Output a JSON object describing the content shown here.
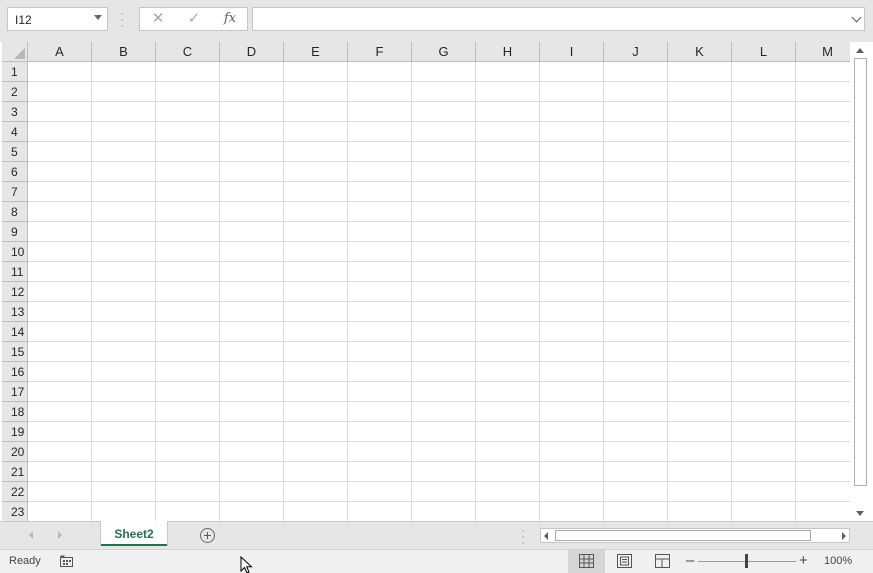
{
  "formula_bar": {
    "name_box_value": "I12",
    "cancel_icon": "✕",
    "enter_icon": "✓",
    "function_icon": "fx",
    "formula_value": ""
  },
  "grid": {
    "columns": [
      "A",
      "B",
      "C",
      "D",
      "E",
      "F",
      "G",
      "H",
      "I",
      "J",
      "K",
      "L",
      "M"
    ],
    "rows": [
      "1",
      "2",
      "3",
      "4",
      "5",
      "6",
      "7",
      "8",
      "9",
      "10",
      "11",
      "12",
      "13",
      "14",
      "15",
      "16",
      "17",
      "18",
      "19",
      "20",
      "21",
      "22",
      "23"
    ]
  },
  "sheet_tabs": {
    "active": "Sheet2",
    "add_icon": "+"
  },
  "status_bar": {
    "status": "Ready",
    "zoom_minus": "–",
    "zoom_plus": "+",
    "zoom_level": "100%"
  },
  "colors": {
    "accent": "#217346",
    "chrome": "#e6e6e6",
    "gridline": "#dadada"
  }
}
